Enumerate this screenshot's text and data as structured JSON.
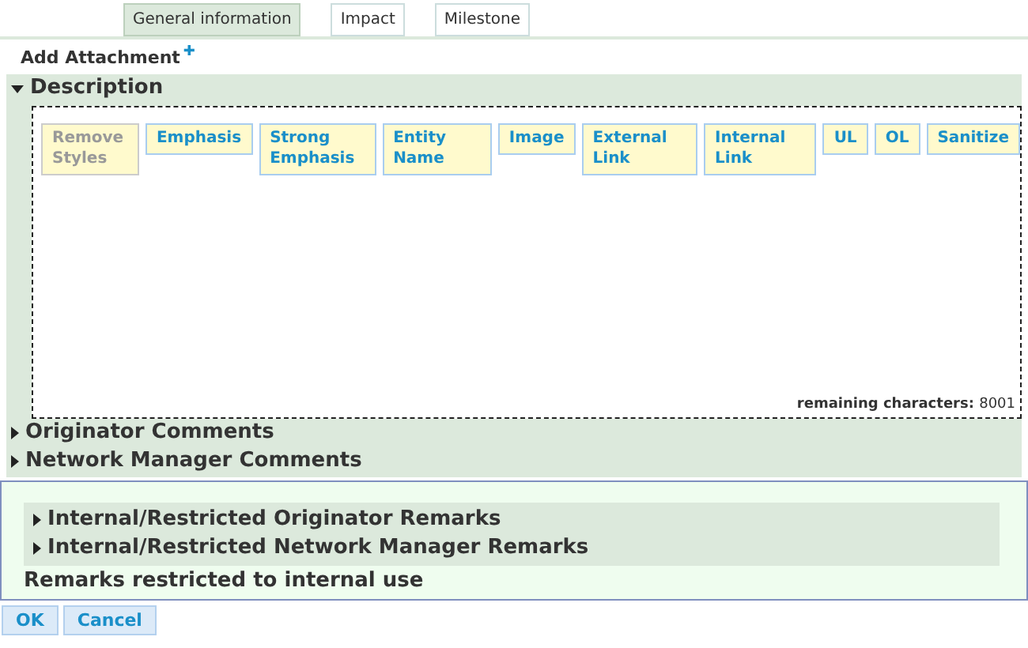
{
  "tabs": [
    {
      "label": "General information",
      "selected": true
    },
    {
      "label": "Impact",
      "selected": false
    },
    {
      "label": "Milestone",
      "selected": false
    }
  ],
  "attachment": {
    "label": "Add Attachment",
    "icon": "✚"
  },
  "description": {
    "title": "Description",
    "expanded": true,
    "toolbar": [
      {
        "label": "Remove Styles",
        "disabled": true
      },
      {
        "label": "Emphasis",
        "disabled": false
      },
      {
        "label": "Strong Emphasis",
        "disabled": false
      },
      {
        "label": "Entity Name",
        "disabled": false
      },
      {
        "label": "Image",
        "disabled": false
      },
      {
        "label": "External Link",
        "disabled": false
      },
      {
        "label": "Internal Link",
        "disabled": false
      },
      {
        "label": "UL",
        "disabled": false
      },
      {
        "label": "OL",
        "disabled": false
      },
      {
        "label": "Sanitize",
        "disabled": false
      }
    ],
    "remaining_label": "remaining characters:",
    "remaining_value": "8001"
  },
  "sections": [
    {
      "title": "Originator Comments",
      "expanded": false
    },
    {
      "title": "Network Manager Comments",
      "expanded": false
    }
  ],
  "internal": {
    "sections": [
      {
        "title": "Internal/Restricted Originator Remarks",
        "expanded": false
      },
      {
        "title": "Internal/Restricted Network Manager Remarks",
        "expanded": false
      }
    ],
    "note": "Remarks restricted to internal use"
  },
  "buttons": [
    "OK",
    "Cancel"
  ]
}
